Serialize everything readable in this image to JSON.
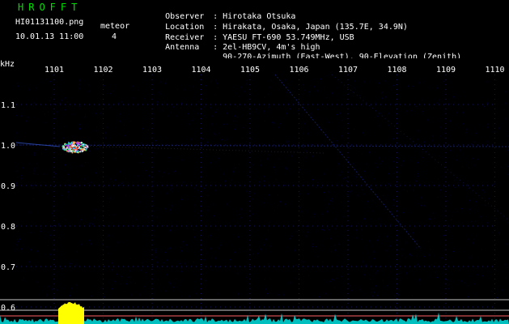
{
  "header": {
    "app_title": "HROFFT",
    "filename": "HI01131100.png",
    "datetime": "10.01.13 11:00",
    "meteor_label": "meteor",
    "meteor_count": "4",
    "station": [
      {
        "key": "Observer",
        "value": "Hirotaka Otsuka"
      },
      {
        "key": "Location",
        "value": "Hirakata, Osaka, Japan (135.7E, 34.9N)"
      },
      {
        "key": "Receiver",
        "value": "YAESU FT-690 53.749MHz, USB"
      },
      {
        "key": "Antenna",
        "value": "2el-HB9CV, 4m's high"
      },
      {
        "key": "",
        "value": "90-270-Azimuth (East-West), 90-Elevation (Zenith)"
      }
    ]
  },
  "spectrogram": {
    "y_unit": "kHz",
    "time_ticks": [
      "1101",
      "1102",
      "1103",
      "1104",
      "1105",
      "1106",
      "1107",
      "1108",
      "1109",
      "1110"
    ],
    "freq_ticks": [
      "1.1",
      "1.0",
      "0.9",
      "0.8",
      "0.7",
      "0.6"
    ],
    "colors": {
      "background": "#000000",
      "noise": "#00003c",
      "trace": "#1a2a8a",
      "meteor_core": "#ff3030",
      "meteor_edge": "#30c0ff",
      "yellow_burst": "#ffff00",
      "cyan_baseline": "#00e0e0",
      "band_line_upper": "#c8c8c8",
      "band_line_lower": "#ff6060"
    }
  }
}
